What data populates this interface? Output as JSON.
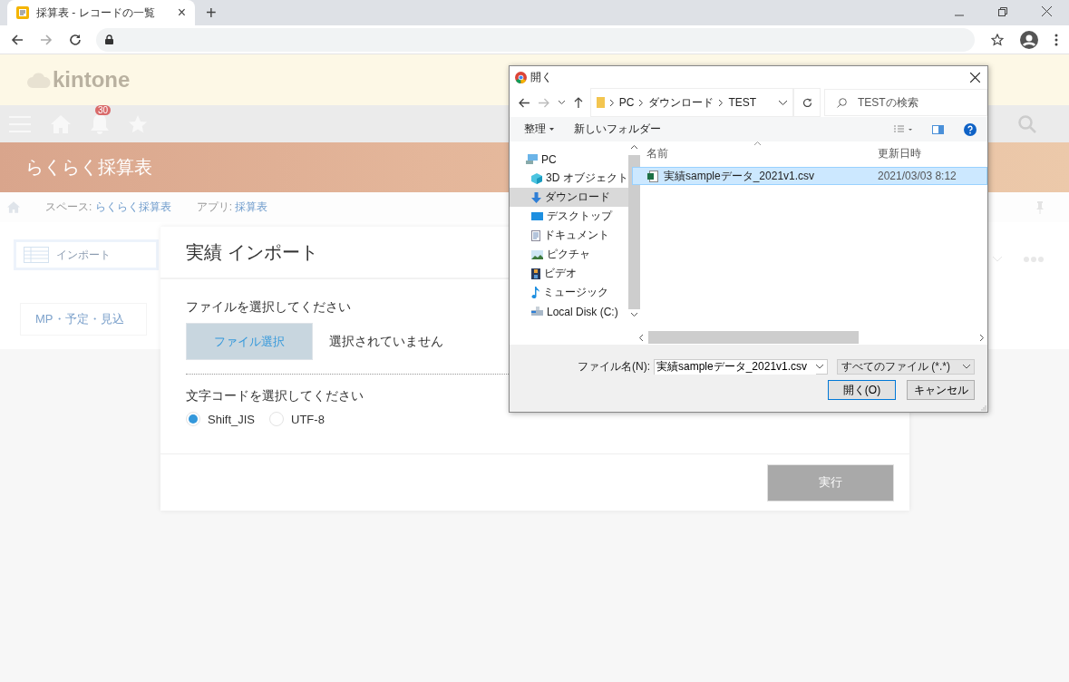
{
  "browser": {
    "tab": {
      "title": "採算表 - レコードの一覧",
      "close": "×"
    },
    "new_tab": "+"
  },
  "app": {
    "logo": "kintone",
    "notification_count": "30",
    "space_title": "らくらく採算表",
    "breadcrumb": [
      {
        "label": "スペース:",
        "link": "らくらく採算表"
      },
      {
        "label": "アプリ:",
        "link": "採算表"
      }
    ],
    "import_button": "インポート",
    "view_button": "MP・予定・見込"
  },
  "modal": {
    "title": "実績 インポート",
    "file_label": "ファイルを選択してください",
    "file_button": "ファイル選択",
    "file_status": "選択されていません",
    "encoding_label": "文字コードを選択してください",
    "encodings": [
      {
        "label": "Shift_JIS",
        "selected": true
      },
      {
        "label": "UTF-8",
        "selected": false
      }
    ],
    "execute_button": {
      "label": "実行",
      "disabled": true
    }
  },
  "file_dialog": {
    "title": "開く",
    "path": [
      "PC",
      "ダウンロード",
      "TEST"
    ],
    "search": {
      "placeholder": "TESTの検索"
    },
    "toolbar": [
      "整理",
      "新しいフォルダー"
    ],
    "sidebar": [
      {
        "label": "PC",
        "kind": "pc",
        "selected": false,
        "children": [
          {
            "label": "3D オブジェクト",
            "kind": "cube",
            "selected": false
          },
          {
            "label": "ダウンロード",
            "kind": "download",
            "selected": true
          },
          {
            "label": "デスクトップ",
            "kind": "desktop",
            "selected": false
          },
          {
            "label": "ドキュメント",
            "kind": "document",
            "selected": false
          },
          {
            "label": "ピクチャ",
            "kind": "picture",
            "selected": false
          },
          {
            "label": "ビデオ",
            "kind": "video",
            "selected": false
          },
          {
            "label": "ミュージック",
            "kind": "music",
            "selected": false
          },
          {
            "label": "Local Disk (C:)",
            "kind": "disk",
            "selected": false
          }
        ]
      }
    ],
    "columns": [
      "名前",
      "更新日時"
    ],
    "files": [
      {
        "name": "実績sampleデータ_2021v1.csv",
        "modified": "2021/03/03 8:12",
        "selected": true
      }
    ],
    "filename_label": "ファイル名(N):",
    "filename": "実績sampleデータ_2021v1.csv",
    "filter": "すべてのファイル (*.*)",
    "buttons": [
      {
        "label": "開く(O)",
        "kind": "default"
      },
      {
        "label": "キャンセル",
        "kind": "normal"
      }
    ]
  }
}
